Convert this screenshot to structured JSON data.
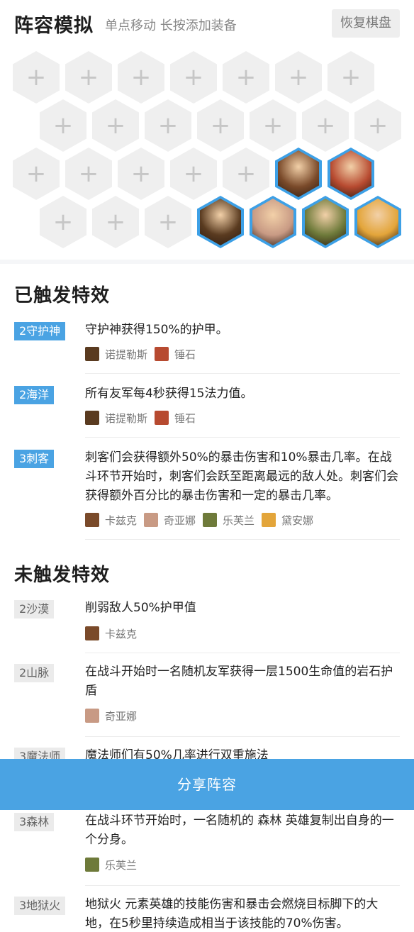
{
  "header": {
    "title": "阵容模拟",
    "subtitle": "单点移动 长按添加装备",
    "reset_label": "恢复棋盘"
  },
  "board": {
    "empty_symbol": "+",
    "champions": [
      {
        "name": "卡兹克",
        "color": "#7a4a2a"
      },
      {
        "name": "锤石",
        "color": "#b74a30"
      },
      {
        "name": "诺提勒斯",
        "color": "#5a3b20"
      },
      {
        "name": "奇亚娜",
        "color": "#c89a84"
      },
      {
        "name": "乐芙兰",
        "color": "#6e7a3a"
      },
      {
        "name": "黛安娜",
        "color": "#e3a53a"
      }
    ]
  },
  "triggered": {
    "title": "已触发特效",
    "traits": [
      {
        "tag": "2守护神",
        "desc": "守护神获得150%的护甲。",
        "champs": [
          "诺提勒斯",
          "锤石"
        ]
      },
      {
        "tag": "2海洋",
        "desc": "所有友军每4秒获得15法力值。",
        "champs": [
          "诺提勒斯",
          "锤石"
        ]
      },
      {
        "tag": "3刺客",
        "desc": "刺客们会获得额外50%的暴击伤害和10%暴击几率。在战斗环节开始时，刺客们会跃至距离最远的敌人处。刺客们会获得额外百分比的暴击伤害和一定的暴击几率。",
        "champs": [
          "卡兹克",
          "奇亚娜",
          "乐芙兰",
          "黛安娜"
        ]
      }
    ]
  },
  "untriggered": {
    "title": "未触发特效",
    "traits": [
      {
        "tag": "2沙漠",
        "desc": "削弱敌人50%护甲值",
        "champs": [
          "卡兹克"
        ]
      },
      {
        "tag": "2山脉",
        "desc": "在战斗开始时一名随机友军获得一层1500生命值的岩石护盾",
        "champs": [
          "奇亚娜"
        ]
      },
      {
        "tag": "3魔法师",
        "desc": "魔法师们有50%几率进行双重施法",
        "champs": []
      },
      {
        "tag": "3森林",
        "desc": "在战斗环节开始时，一名随机的 森林 英雄复制出自身的一个分身。",
        "champs": [
          "乐芙兰"
        ]
      },
      {
        "tag": "3地狱火",
        "desc": "地狱火 元素英雄的技能伤害和暴击会燃烧目标脚下的大地，在5秒里持续造成相当于该技能的70%伤害。",
        "champs": []
      }
    ]
  },
  "share": {
    "label": "分享阵容"
  },
  "colors": {
    "accent": "#4aa3e3",
    "hex_empty": "#efefef"
  }
}
